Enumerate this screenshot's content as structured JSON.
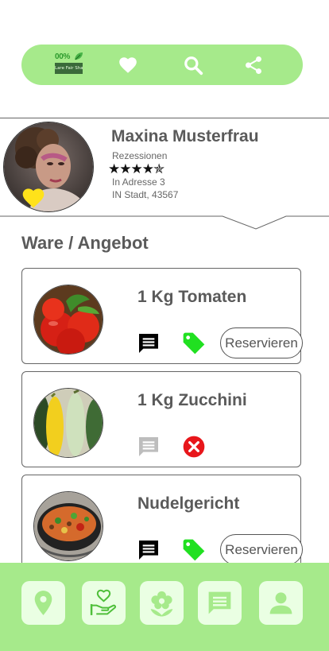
{
  "top_bar": {
    "logo": {
      "percent": "00%",
      "text": "Lare Fair Share"
    },
    "icons": [
      "heart-icon",
      "search-icon",
      "share-icon"
    ]
  },
  "profile": {
    "name": "Maxina Musterfrau",
    "reviews_label": "Rezessionen",
    "rating": 4.5,
    "rating_stars": "★★★★✯",
    "address_line1": "In Adresse 3",
    "address_line2": "IN Stadt, 43567"
  },
  "section": {
    "title": "Ware / Angebot"
  },
  "offers": [
    {
      "title": "1 Kg Tomaten",
      "chat_active": true,
      "status": "available",
      "reserve_label": "Reservieren"
    },
    {
      "title": "1 Kg Zucchini",
      "chat_active": false,
      "status": "unavailable"
    },
    {
      "title": "Nudelgericht",
      "chat_active": true,
      "status": "available",
      "reserve_label": "Reservieren"
    }
  ],
  "bottom_nav": {
    "items": [
      "location-pin-icon",
      "donate-heart-hand-icon",
      "flower-icon",
      "chat-icon",
      "user-icon"
    ]
  },
  "colors": {
    "accent_green": "#a6ea8b",
    "nav_button_bg": "#eaffe3",
    "tag_green": "#21e021",
    "heart_yellow": "#ffe21a",
    "error_red": "#e8161b"
  }
}
